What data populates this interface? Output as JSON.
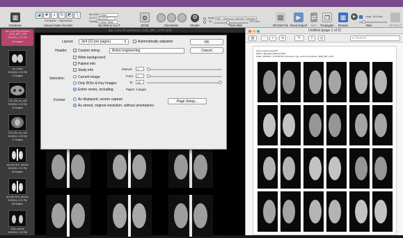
{
  "toolbar": {
    "database": "Database",
    "mouse_button_function": "Mouse button function",
    "left_button": "Left Button",
    "right_button": "Right Button",
    "wlww_label": "WL/WW & CLUT",
    "wlww_field": "WL/WW",
    "wlww_value": "Other",
    "clut_field": "CLUT",
    "clut_value": "No CLUT",
    "opacity_field": "Opacity",
    "opacity_value": "Linear Table",
    "twod3d": "2D/3D",
    "orientation": "Orientation",
    "shutter": "Shutter",
    "thick_slab": "Thick Slab",
    "mode_label": "Mode",
    "mode_value": "MIP - Maximum Intensity Projection",
    "slab_2d": "2D",
    "slab_mm": "30.0 mm",
    "dicom_file": "DICOM File",
    "movie_export": "Movie Export",
    "sync": "Sync",
    "propagate": "Propagate",
    "browse": "Browse",
    "loop": "Loop",
    "rate_value": "10.0 im/s",
    "rate": "Rate",
    "threed_panel": "3D Panel"
  },
  "sidebar": {
    "series": [
      {
        "name": "dyn_echo bh perfusion _SUB_MIP_COR",
        "date": "20/09/04, 2:16 PM",
        "count": "46 images"
      },
      {
        "name": "cor_haste",
        "date": "20/09/04, 2:20 PM",
        "count": "72 images"
      },
      {
        "name": "T2S_t2fs_tra_shif",
        "date": "20/09/04, 2:20 PM",
        "count": "33 images"
      },
      {
        "name": "T2S_t2fs_cor_shif",
        "date": "20/09/04, 2:20 PM",
        "count": "17 images"
      },
      {
        "name": "dyn-tkb-3cm_arterial",
        "date": "20/09/04, 2:22 PM",
        "count": "66 images"
      },
      {
        "name": "dyn-tkb-3cm_venous",
        "date": "20/09/04, 2:22 PM",
        "count": "66 images"
      },
      {
        "name": "SUB_arterial",
        "date": "20/09/04, 2:22 PM",
        "count": ""
      }
    ]
  },
  "viewer": {
    "title": "dyn_echo bh perfusion_SUB_MIP_COR (4/3)"
  },
  "dialog": {
    "layout_label": "Layout:",
    "layout_value": "3x4 (12 per pages)",
    "auto_adjusted": "Automatically adjusted",
    "ok": "OK",
    "cancel": "Cancel",
    "header_label": "Header:",
    "custom_string": "Custom string:",
    "custom_value": "Acton engineering",
    "write_background": "Write background",
    "patient_info": "Patient info",
    "study_info": "Study info",
    "selection_label": "Selection:",
    "current_image": "Current image",
    "only_rois": "Only ROIs & Key Images",
    "entire_series": "Entire series, including:",
    "interval_label": "Interval:",
    "interval_value": "1",
    "from_label": "From:",
    "from_value": "1",
    "to_label": "To:",
    "to_value": "15",
    "pages": "Pages: 2 pages",
    "format_label": "Format:",
    "as_displayed": "As displayed, screen capture",
    "as_stored": "As stored, original resolution, without annotations",
    "page_setup": "Page Setup..."
  },
  "preview": {
    "title": "Untitled (page 1 of 2)",
    "search_placeholder": "Search",
    "header_line1": "Acton engineering   2/15",
    "header_line2": "Patient: Beautiful (2018-ail-001)",
    "header_line3": "Study: 23/09/04 - 2:16 PM    Film Admiumer: dyn_echo bh perfusion_SUB_MIP_COR"
  }
}
